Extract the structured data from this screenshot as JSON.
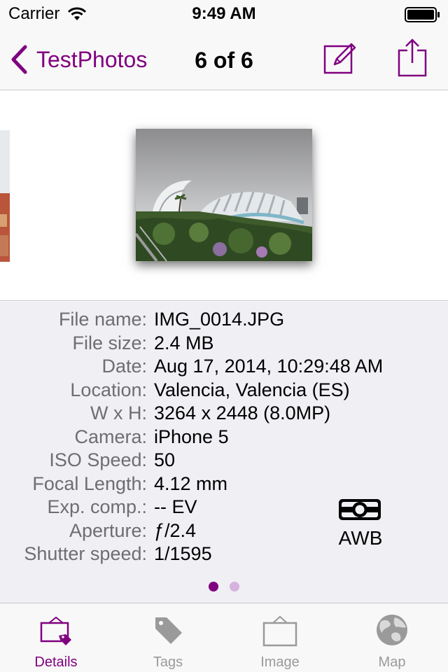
{
  "status_bar": {
    "carrier": "Carrier",
    "time": "9:49 AM"
  },
  "nav": {
    "back_label": "TestPhotos",
    "title": "6 of 6",
    "edit_icon": "compose-icon",
    "share_icon": "share-icon"
  },
  "details": {
    "rows": [
      {
        "label": "File name:",
        "value": "IMG_0014.JPG"
      },
      {
        "label": "File size:",
        "value": "2.4 MB"
      },
      {
        "label": "Date:",
        "value": "Aug 17, 2014, 10:29:48 AM"
      },
      {
        "label": "Location:",
        "value": "Valencia, Valencia (ES)"
      },
      {
        "label": "W x H:",
        "value": "3264 x 2448 (8.0MP)"
      },
      {
        "label": "Camera:",
        "value": "iPhone 5"
      },
      {
        "label": "ISO Speed:",
        "value": "50"
      },
      {
        "label": "Focal Length:",
        "value": "4.12 mm"
      },
      {
        "label": "Exp. comp.:",
        "value": "--  EV"
      },
      {
        "label": "Aperture:",
        "value": "ƒ/2.4"
      },
      {
        "label": "Shutter speed:",
        "value": "1/1595"
      }
    ],
    "white_balance": "AWB",
    "page_dots": {
      "count": 2,
      "active_index": 0
    }
  },
  "tabs": [
    {
      "label": "Details",
      "icon": "details-frame-icon",
      "active": true
    },
    {
      "label": "Tags",
      "icon": "tag-icon",
      "active": false
    },
    {
      "label": "Image",
      "icon": "image-frame-icon",
      "active": false
    },
    {
      "label": "Map",
      "icon": "globe-icon",
      "active": false
    }
  ],
  "colors": {
    "accent": "#800080",
    "label_gray": "#6d6d72",
    "panel_bg": "#efeff4",
    "tab_inactive": "#9a9a9a"
  }
}
